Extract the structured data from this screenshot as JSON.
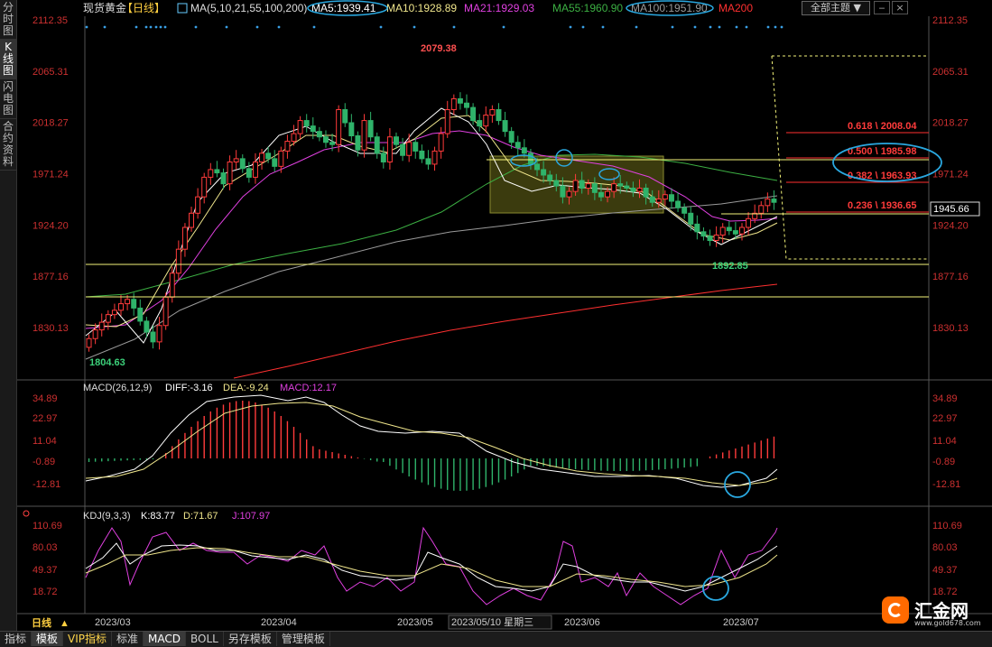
{
  "left_tabs": [
    "分时图",
    "K线图",
    "闪电图",
    "合约资料"
  ],
  "left_tabs_active": 1,
  "header": {
    "instrument": "现货黄金",
    "period": "【日线】",
    "ma_title": "MA(5,10,21,55,100,200)",
    "ma5": "MA5:1939.41",
    "ma10": "MA10:1928.89",
    "ma21": "MA21:1929.03",
    "ma55": "MA55:1960.90",
    "ma100": "MA100:1951.90",
    "ma200": "MA200",
    "theme_select": "全部主题",
    "theme_icon": "dropdown-triangle-icon",
    "window_icons": [
      "minimize-icon",
      "close-icon"
    ]
  },
  "price_axis": [
    "2112.35",
    "2065.31",
    "2018.27",
    "1971.24",
    "1924.20",
    "1877.16",
    "1830.13"
  ],
  "current_price": "1945.66",
  "annotations": {
    "high": "2079.38",
    "low_left": "1804.63",
    "low_right": "1892.85"
  },
  "fibonacci": [
    {
      "label": "0.618 \\ 2008.04"
    },
    {
      "label": "0.500 \\ 1985.98"
    },
    {
      "label": "0.382 \\ 1963.93"
    },
    {
      "label": "0.236 \\ 1936.65"
    }
  ],
  "macd": {
    "title": "MACD(26,12,9)",
    "diff": "DIFF:-3.16",
    "dea": "DEA:-9.24",
    "macd": "MACD:12.17",
    "axis": [
      "34.89",
      "22.97",
      "11.04",
      "-0.89",
      "-12.81"
    ]
  },
  "kdj": {
    "title": "KDJ(9,3,3)",
    "k": "K:83.77",
    "d": "D:71.67",
    "j": "J:107.97",
    "axis": [
      "110.69",
      "80.03",
      "49.37",
      "18.72"
    ]
  },
  "time_axis": {
    "period_label": "日线",
    "labels": [
      "2023/03",
      "2023/04",
      "2023/05",
      "2023/06",
      "2023/07"
    ],
    "cursor": "2023/05/10 星期三"
  },
  "bottom_tabs": [
    "指标",
    "模板",
    "VIP指标",
    "标准",
    "MACD",
    "BOLL",
    "另存模板",
    "管理模板"
  ],
  "bottom_tabs_active": [
    1,
    4
  ],
  "logo": {
    "name": "汇金网",
    "url": "www.gold678.com"
  },
  "colors": {
    "up": "#ff3b3b",
    "down": "#2fb36a",
    "ma5": "#ffffff",
    "ma10": "#f0e68c",
    "ma21": "#e040e0",
    "ma55": "#3cb043",
    "ma100": "#9a9a9a",
    "ma200": "#ff3030",
    "fib": "#ff3030",
    "support": "#f5f57a",
    "highlight": "#2aa8e0",
    "box": "#6b6b1a"
  },
  "chart_data": {
    "type": "candlestick",
    "x_range": [
      "2023/03",
      "2023/07"
    ],
    "y_range": [
      1804.63,
      2112.35
    ],
    "price_axis": [
      2112.35,
      2065.31,
      2018.27,
      1971.24,
      1924.2,
      1877.16,
      1830.13
    ],
    "closes": [
      1820,
      1828,
      1835,
      1842,
      1846,
      1852,
      1856,
      1848,
      1836,
      1826,
      1817,
      1832,
      1858,
      1880,
      1902,
      1922,
      1935,
      1950,
      1968,
      1975,
      1972,
      1962,
      1982,
      1985,
      1976,
      1968,
      1982,
      1990,
      1985,
      1978,
      1992,
      2001,
      2008,
      2020,
      2015,
      2010,
      2005,
      2000,
      1998,
      2030,
      2018,
      2006,
      1993,
      2020,
      2005,
      1990,
      1982,
      2005,
      1998,
      1988,
      2000,
      1992,
      1985,
      1980,
      1992,
      2008,
      2030,
      2040,
      2036,
      2032,
      2020,
      2015,
      2025,
      2030,
      2020,
      2010,
      2000,
      1995,
      1990,
      1980,
      1975,
      1970,
      1965,
      1960,
      1950,
      1955,
      1965,
      1958,
      1962,
      1954,
      1950,
      1955,
      1962,
      1960,
      1958,
      1955,
      1958,
      1950,
      1945,
      1948,
      1952,
      1946,
      1940,
      1935,
      1925,
      1918,
      1914,
      1910,
      1915,
      1922,
      1919,
      1916,
      1922,
      1930,
      1935,
      1942,
      1948,
      1945
    ],
    "horizontal_levels": [
      2008.04,
      1985.98,
      1963.93,
      1936.65,
      1892.85
    ],
    "macd_axis": [
      34.89,
      22.97,
      11.04,
      -0.89,
      -12.81
    ],
    "kdj_axis": [
      110.69,
      80.03,
      49.37,
      18.72
    ]
  }
}
